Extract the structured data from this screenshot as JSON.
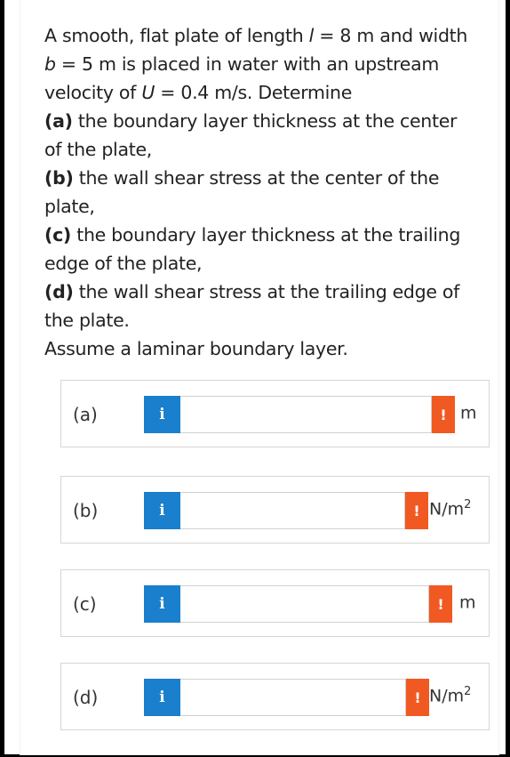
{
  "question": {
    "lines": [
      {
        "parts": [
          {
            "t": "A smooth, flat plate of length "
          },
          {
            "t": "l",
            "i": true
          },
          {
            "t": " = 8 m and width"
          }
        ]
      },
      {
        "parts": [
          {
            "t": "b",
            "i": true
          },
          {
            "t": " = 5 m is placed in water with an upstream"
          }
        ]
      },
      {
        "parts": [
          {
            "t": "velocity of "
          },
          {
            "t": "U",
            "i": true
          },
          {
            "t": " = 0.4 m/s. Determine"
          }
        ]
      },
      {
        "parts": [
          {
            "t": "(a)",
            "b": true
          },
          {
            "t": " the boundary layer thickness at the center"
          }
        ]
      },
      {
        "parts": [
          {
            "t": "of the plate,"
          }
        ]
      },
      {
        "parts": [
          {
            "t": "(b)",
            "b": true
          },
          {
            "t": " the wall shear stress at the center of the"
          }
        ]
      },
      {
        "parts": [
          {
            "t": "plate,"
          }
        ]
      },
      {
        "parts": [
          {
            "t": "(c)",
            "b": true
          },
          {
            "t": " the boundary layer thickness at the trailing"
          }
        ]
      },
      {
        "parts": [
          {
            "t": "edge of the plate,"
          }
        ]
      },
      {
        "parts": [
          {
            "t": "(d)",
            "b": true
          },
          {
            "t": " the wall shear stress at the trailing edge of"
          }
        ]
      },
      {
        "parts": [
          {
            "t": "the plate."
          }
        ]
      },
      {
        "parts": [
          {
            "t": "Assume a laminar boundary layer."
          }
        ]
      }
    ]
  },
  "answers": [
    {
      "label": "(a)",
      "info_glyph": "i",
      "warn_glyph": "!",
      "value": "",
      "unit": "m",
      "unit_sup": ""
    },
    {
      "label": "(b)",
      "info_glyph": "i",
      "warn_glyph": "!",
      "value": "",
      "unit": "N/m",
      "unit_sup": "2"
    },
    {
      "label": "(c)",
      "info_glyph": "i",
      "warn_glyph": "!",
      "value": "",
      "unit": "m",
      "unit_sup": ""
    },
    {
      "label": "(d)",
      "info_glyph": "i",
      "warn_glyph": "!",
      "value": "",
      "unit": "N/m",
      "unit_sup": "2"
    }
  ],
  "colors": {
    "info": "#1a7fcc",
    "warning": "#f05a22"
  },
  "icons": {
    "info": "info-icon",
    "warning": "warning-icon"
  }
}
